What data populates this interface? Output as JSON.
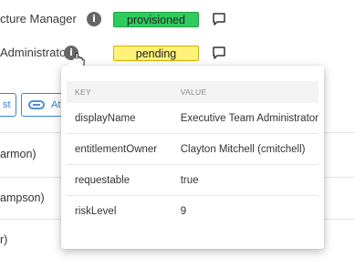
{
  "roles": [
    {
      "label": "cture Manager",
      "status": "provisioned",
      "status_color": "#2ecc5f"
    },
    {
      "label": "Administrator",
      "status": "pending",
      "status_color": "#fff27a"
    }
  ],
  "actions": {
    "first_label": "st",
    "second_label": "Att"
  },
  "owners": [
    {
      "text": "armon)"
    },
    {
      "text": "ampson)"
    },
    {
      "text": "r)"
    }
  ],
  "popover": {
    "header_key": "KEY",
    "header_value": "VALUE",
    "rows": [
      {
        "key": "displayName",
        "value": "Executive Team Administrator"
      },
      {
        "key": "entitlementOwner",
        "value": "Clayton Mitchell (cmitchell)"
      },
      {
        "key": "requestable",
        "value": "true"
      },
      {
        "key": "riskLevel",
        "value": "9"
      }
    ]
  },
  "icons": {
    "info": "info-icon",
    "comment": "comment-icon",
    "attach": "attach-icon",
    "cursor": "hand-cursor"
  }
}
